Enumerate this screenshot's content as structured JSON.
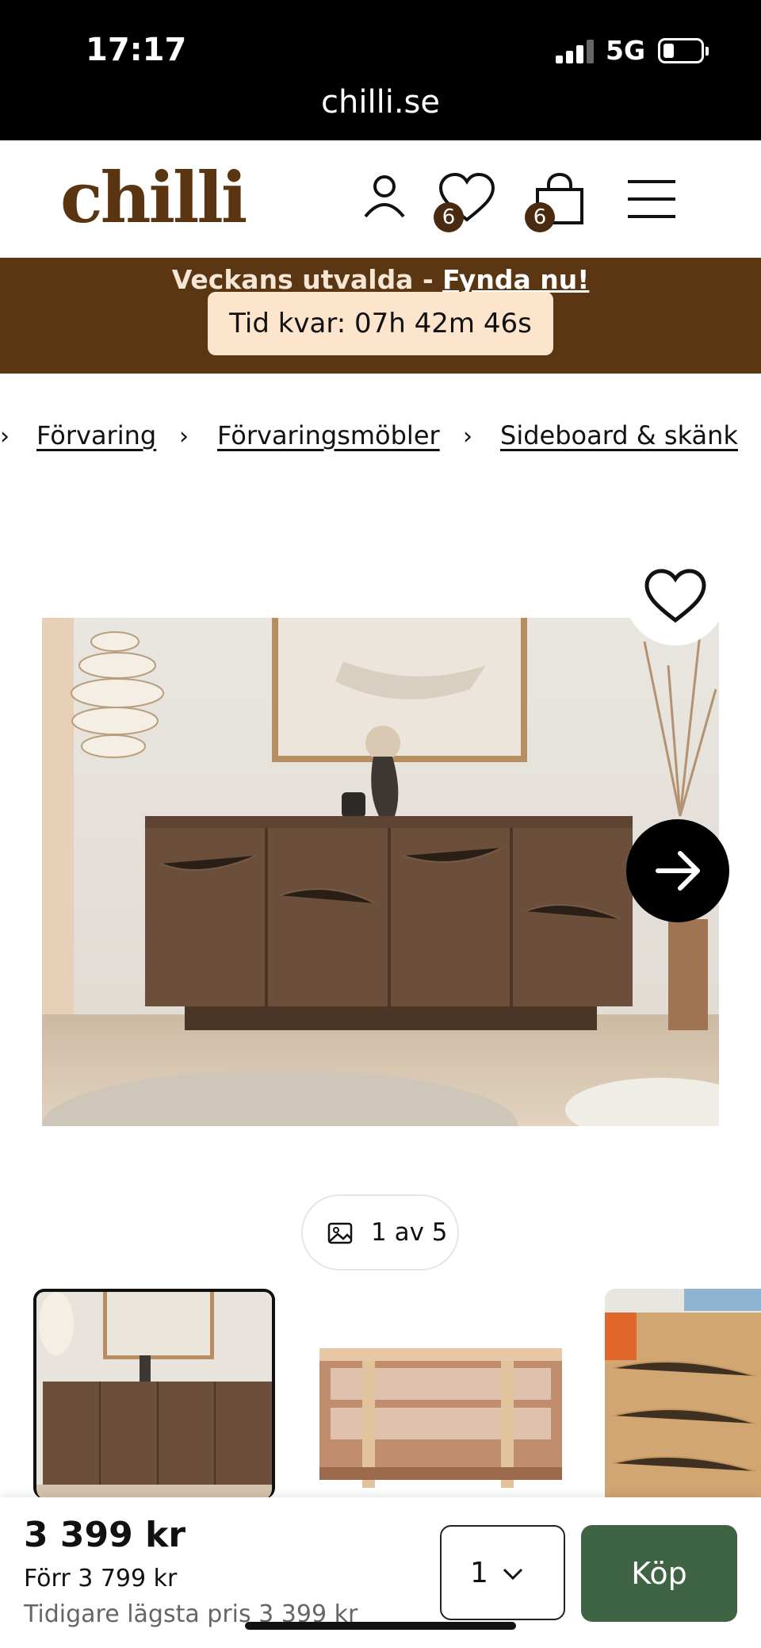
{
  "status_bar": {
    "time": "17:17",
    "network": "5G",
    "url": "chilli.se"
  },
  "header": {
    "logo": "chilli",
    "wishlist_count": "6",
    "cart_count": "6"
  },
  "promo": {
    "text": "Veckans utvalda - ",
    "link": "Fynda nu!",
    "timer": "Tid kvar: 07h 42m 46s"
  },
  "breadcrumb": [
    "Förvaring",
    "Förvaringsmöbler",
    "Sideboard & skänk"
  ],
  "gallery": {
    "counter": "1 av 5",
    "current": 1,
    "total": 5
  },
  "buy_bar": {
    "price": "3 399 kr",
    "old_price": "Förr 3 799 kr",
    "lowest_price": "Tidigare lägsta pris 3 399 kr",
    "quantity": "1",
    "buy_label": "Köp"
  },
  "colors": {
    "brand": "#5b3612",
    "buy_button": "#3f6443",
    "timer_bg": "#fde4cc"
  }
}
